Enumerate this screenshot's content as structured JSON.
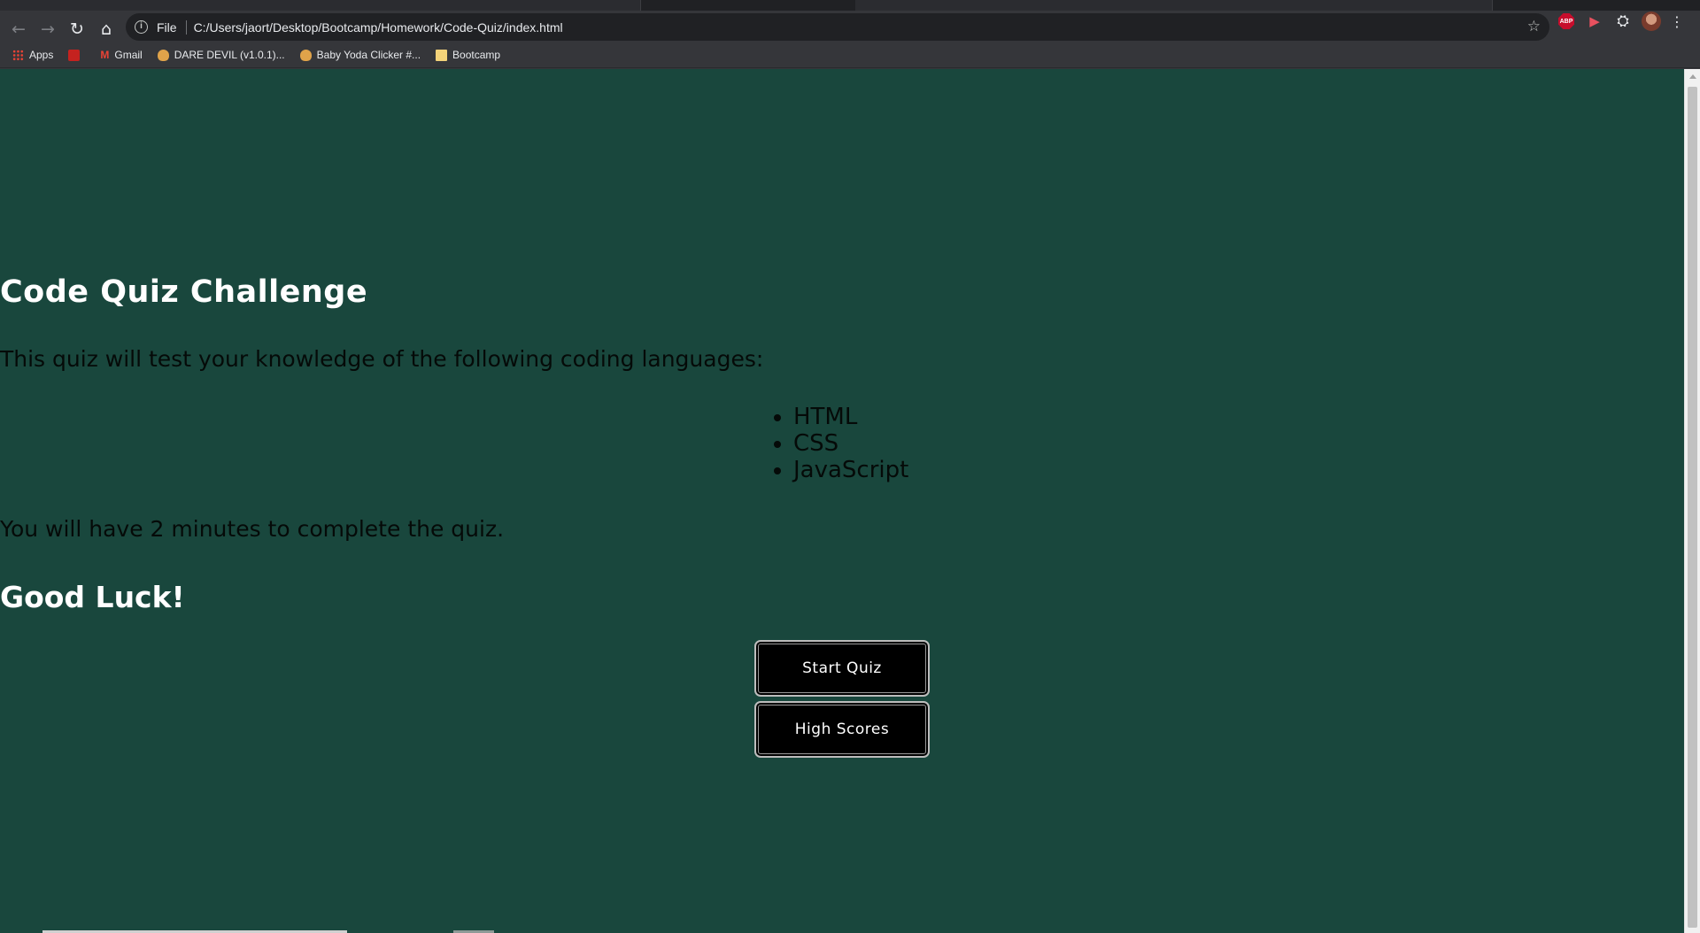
{
  "browser": {
    "address_scheme": "File",
    "address_url": "C:/Users/jaort/Desktop/Bootcamp/Homework/Code-Quiz/index.html",
    "bookmarks": [
      {
        "label": "Apps",
        "icon": "apps-grid-icon"
      },
      {
        "label": "",
        "icon": "red-bookmark-icon"
      },
      {
        "label": "Gmail",
        "icon": "gmail-icon"
      },
      {
        "label": "DARE DEVIL (v1.0.1)...",
        "icon": "cookie-icon"
      },
      {
        "label": "Baby Yoda Clicker #...",
        "icon": "cookie-icon"
      },
      {
        "label": "Bootcamp",
        "icon": "folder-icon"
      }
    ],
    "extensions": [
      "adblock-plus-icon",
      "screen-recorder-icon",
      "puzzle-extensions-icon",
      "profile-avatar-icon",
      "menu-icon"
    ]
  },
  "quiz": {
    "title": "Code Quiz Challenge",
    "intro": "This quiz will test your knowledge of the following coding languages:",
    "languages": [
      "HTML",
      "CSS",
      "JavaScript"
    ],
    "timer_note": "You will have 2 minutes to complete the quiz.",
    "good_luck": "Good Luck!",
    "start_label": "Start Quiz",
    "scores_label": "High Scores"
  },
  "colors": {
    "page_background": "#19473d",
    "heading_text": "#ffffff",
    "body_text": "#050a08",
    "button_background": "#000000"
  }
}
